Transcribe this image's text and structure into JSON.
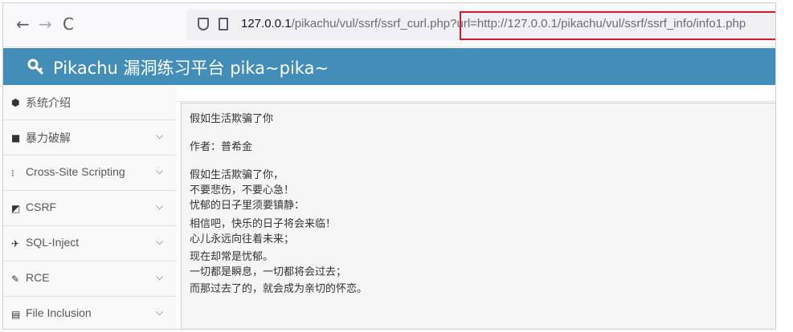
{
  "browser": {
    "nav": {
      "back": "←",
      "forward": "→",
      "reload": "C"
    },
    "url_host": "127.0.0.1",
    "url_rest": "/pikachu/vul/ssrf/ssrf_curl.php?url=http://127.0.0.1/pikachu/vul/ssrf/ssrf_info/info1.php",
    "highlight_color": "#d11a2a"
  },
  "app": {
    "title": "Pikachu 漏洞练习平台 pika~pika~",
    "header_color": "#438eb9"
  },
  "sidebar": {
    "items": [
      {
        "label": "系统介绍",
        "icon": "tag-icon"
      },
      {
        "label": "暴力破解",
        "icon": "lock-icon",
        "arrow": "⌵"
      },
      {
        "label": "Cross-Site Scripting",
        "icon": "filter-icon",
        "arrow": "⌵"
      },
      {
        "label": "CSRF",
        "icon": "share-icon",
        "arrow": "⌵"
      },
      {
        "label": "SQL-Inject",
        "icon": "plane-icon",
        "arrow": "⌵"
      },
      {
        "label": "RCE",
        "icon": "pencil-icon",
        "arrow": "⌵"
      },
      {
        "label": "File Inclusion",
        "icon": "file-icon",
        "arrow": "⌵"
      }
    ]
  },
  "content": {
    "lines": [
      "假如生活欺骗了你",
      "作者：普希金",
      "假如生活欺骗了你，",
      "不要悲伤，不要心急！",
      "忧郁的日子里须要镇静：",
      "相信吧，快乐的日子将会来临！",
      "心儿永远向往着未来；",
      "现在却常是忧郁。",
      "一切都是瞬息，一切都将会过去；",
      "而那过去了的，就会成为亲切的怀恋。"
    ]
  }
}
